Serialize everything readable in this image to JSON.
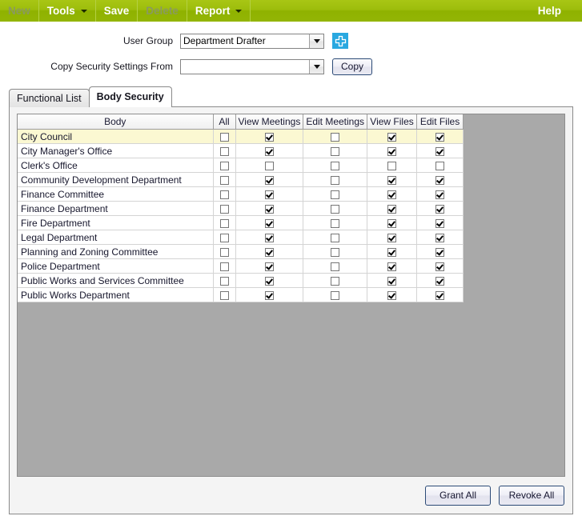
{
  "menubar": {
    "items": [
      {
        "label": "New",
        "disabled": true,
        "caret": false
      },
      {
        "label": "Tools",
        "disabled": false,
        "caret": true
      },
      {
        "label": "Save",
        "disabled": false,
        "caret": false
      },
      {
        "label": "Delete",
        "disabled": true,
        "caret": false
      },
      {
        "label": "Report",
        "disabled": false,
        "caret": true
      }
    ],
    "help_label": "Help",
    "background_color": "#9dbd0c",
    "text_color": "#ffffff",
    "disabled_text_color": "#8a9a5f"
  },
  "form": {
    "user_group": {
      "label": "User Group",
      "value": "Department Drafter",
      "placeholder": "",
      "add_button_icon": "plus-icon",
      "add_button_color": "#29a8e0"
    },
    "copy_security": {
      "label": "Copy Security Settings From",
      "value": "",
      "placeholder": "",
      "copy_button_label": "Copy"
    }
  },
  "tabs": [
    {
      "label": "Functional List",
      "active": false
    },
    {
      "label": "Body Security",
      "active": true
    }
  ],
  "grid": {
    "columns": [
      "Body",
      "All",
      "View Meetings",
      "Edit Meetings",
      "View Files",
      "Edit Files"
    ],
    "selected_row_color": "#fbf8d2",
    "rows": [
      {
        "body": "City Council",
        "all": false,
        "view_meetings": true,
        "edit_meetings": false,
        "view_files": true,
        "edit_files": true,
        "selected": true
      },
      {
        "body": "City Manager's Office",
        "all": false,
        "view_meetings": true,
        "edit_meetings": false,
        "view_files": true,
        "edit_files": true,
        "selected": false
      },
      {
        "body": "Clerk's Office",
        "all": false,
        "view_meetings": false,
        "edit_meetings": false,
        "view_files": false,
        "edit_files": false,
        "selected": false
      },
      {
        "body": "Community Development Department",
        "all": false,
        "view_meetings": true,
        "edit_meetings": false,
        "view_files": true,
        "edit_files": true,
        "selected": false
      },
      {
        "body": "Finance Committee",
        "all": false,
        "view_meetings": true,
        "edit_meetings": false,
        "view_files": true,
        "edit_files": true,
        "selected": false
      },
      {
        "body": "Finance Department",
        "all": false,
        "view_meetings": true,
        "edit_meetings": false,
        "view_files": true,
        "edit_files": true,
        "selected": false
      },
      {
        "body": "Fire Department",
        "all": false,
        "view_meetings": true,
        "edit_meetings": false,
        "view_files": true,
        "edit_files": true,
        "selected": false
      },
      {
        "body": "Legal Department",
        "all": false,
        "view_meetings": true,
        "edit_meetings": false,
        "view_files": true,
        "edit_files": true,
        "selected": false
      },
      {
        "body": "Planning and Zoning Committee",
        "all": false,
        "view_meetings": true,
        "edit_meetings": false,
        "view_files": true,
        "edit_files": true,
        "selected": false
      },
      {
        "body": "Police Department",
        "all": false,
        "view_meetings": true,
        "edit_meetings": false,
        "view_files": true,
        "edit_files": true,
        "selected": false
      },
      {
        "body": "Public Works and Services Committee",
        "all": false,
        "view_meetings": true,
        "edit_meetings": false,
        "view_files": true,
        "edit_files": true,
        "selected": false
      },
      {
        "body": "Public Works Department",
        "all": false,
        "view_meetings": true,
        "edit_meetings": false,
        "view_files": true,
        "edit_files": true,
        "selected": false
      }
    ]
  },
  "footer": {
    "grant_all_label": "Grant All",
    "revoke_all_label": "Revoke All"
  }
}
